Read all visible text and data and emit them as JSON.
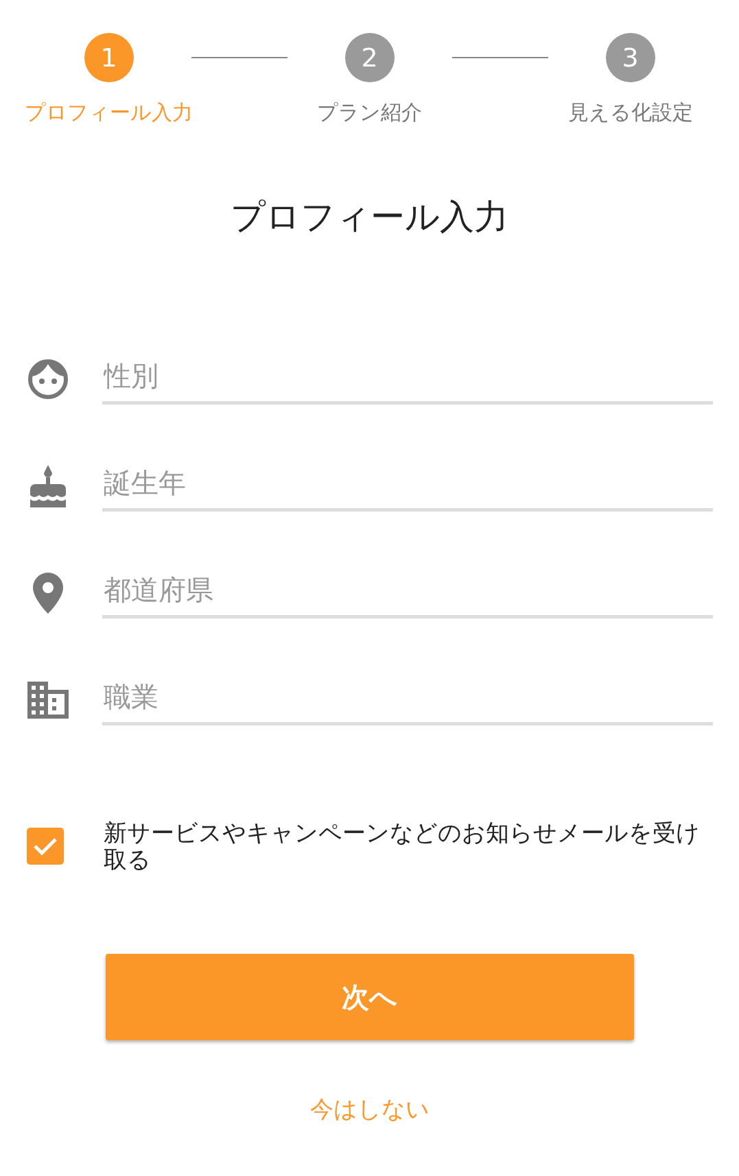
{
  "stepper": [
    {
      "number": "1",
      "label": "プロフィール入力",
      "selected": true
    },
    {
      "number": "2",
      "label": "プラン紹介",
      "selected": false
    },
    {
      "number": "3",
      "label": "見える化設定",
      "selected": false
    }
  ],
  "title": "プロフィール入力",
  "fields": [
    {
      "kind": "face",
      "placeholder": "性別"
    },
    {
      "kind": "cake",
      "placeholder": "誕生年"
    },
    {
      "kind": "pin",
      "placeholder": "都道府県"
    },
    {
      "kind": "building",
      "placeholder": "職業"
    }
  ],
  "newsletter": {
    "label": "新サービスやキャンペーンなどのお知らせメールを受け取る",
    "checked": true
  },
  "next_button": "次へ",
  "skip_link": "今はしない"
}
